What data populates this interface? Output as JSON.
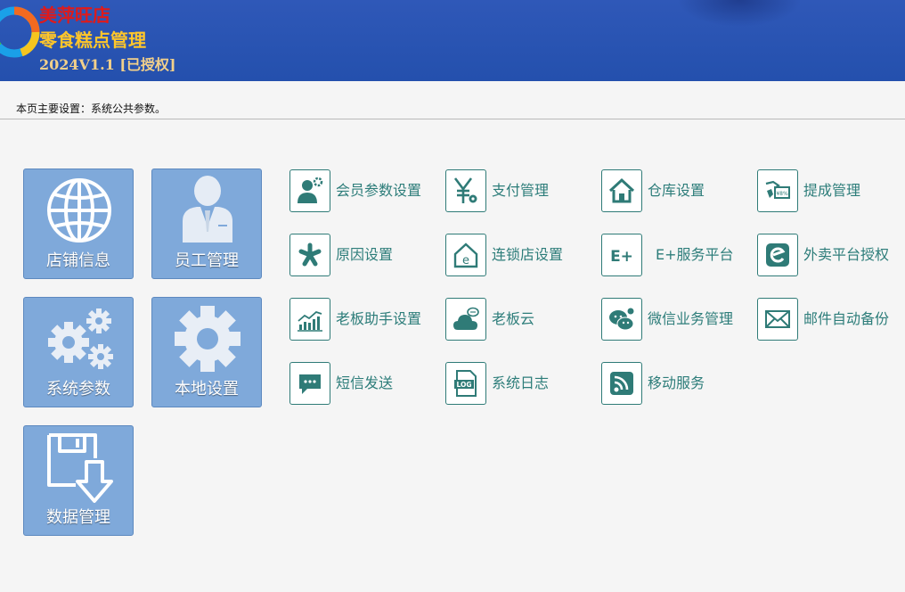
{
  "header": {
    "store_name": "美萍旺店",
    "product_name": "零食糕点管理",
    "version": "2024V1.1 [已授权]"
  },
  "page_description": "本页主要设置：系统公共参数。",
  "colors": {
    "header_bg": "#2f58b8",
    "tile_bg": "#7fa9da",
    "icon_teal": "#2f7b77",
    "label_teal": "#2d7d7a",
    "store_name_red": "#e01a1a",
    "product_name_gold": "#ffc62a"
  },
  "tiles": [
    {
      "label": "店铺信息",
      "icon": "globe-icon"
    },
    {
      "label": "员工管理",
      "icon": "employee-icon"
    },
    {
      "label": "系统参数",
      "icon": "gears-icon"
    },
    {
      "label": "本地设置",
      "icon": "gear-icon"
    },
    {
      "label": "数据管理",
      "icon": "floppy-download-icon"
    }
  ],
  "items": [
    {
      "label": "会员参数设置",
      "icon": "member-settings-icon"
    },
    {
      "label": "支付管理",
      "icon": "yen-gear-icon"
    },
    {
      "label": "仓库设置",
      "icon": "warehouse-house-icon"
    },
    {
      "label": "提成管理",
      "icon": "commission-hand-icon"
    },
    {
      "label": "原因设置",
      "icon": "asterisk-icon"
    },
    {
      "label": "连锁店设置",
      "icon": "chain-store-icon"
    },
    {
      "label": "E+服务平台",
      "icon": "eplus-icon"
    },
    {
      "label": "外卖平台授权",
      "icon": "takeout-e-icon"
    },
    {
      "label": "老板助手设置",
      "icon": "trend-chart-icon"
    },
    {
      "label": "老板云",
      "icon": "cloud-chat-icon"
    },
    {
      "label": "微信业务管理",
      "icon": "wechat-icon"
    },
    {
      "label": "邮件自动备份",
      "icon": "mail-icon"
    },
    {
      "label": "短信发送",
      "icon": "sms-bubble-icon"
    },
    {
      "label": "系统日志",
      "icon": "log-file-icon"
    },
    {
      "label": "移动服务",
      "icon": "rss-icon"
    }
  ]
}
